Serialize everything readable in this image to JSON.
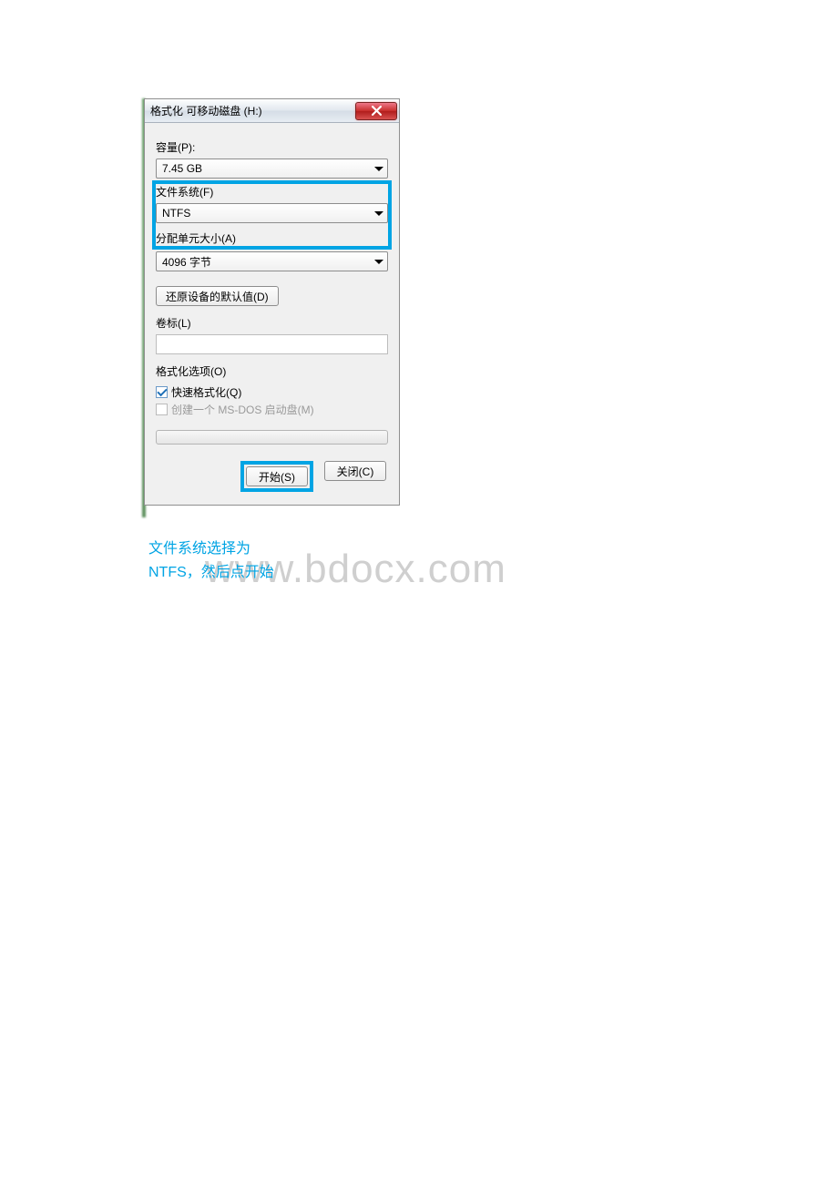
{
  "dialog": {
    "title": "格式化 可移动磁盘 (H:)",
    "labels": {
      "capacity": "容量(P):",
      "filesystem": "文件系统(F)",
      "allocation": "分配单元大小(A)",
      "restore_defaults": "还原设备的默认值(D)",
      "volume_label": "卷标(L)",
      "options": "格式化选项(O)",
      "quick_format": "快速格式化(Q)",
      "msdos_boot": "创建一个 MS-DOS 启动盘(M)",
      "start": "开始(S)",
      "close": "关闭(C)"
    },
    "values": {
      "capacity": "7.45 GB",
      "filesystem": "NTFS",
      "allocation": "4096 字节",
      "volume_label": "",
      "quick_format_checked": true,
      "msdos_boot_enabled": false
    }
  },
  "annotation": {
    "line1": "文件系统选择为",
    "line2": "NTFS，然后点开始"
  },
  "watermark": "www.bdocx.com"
}
